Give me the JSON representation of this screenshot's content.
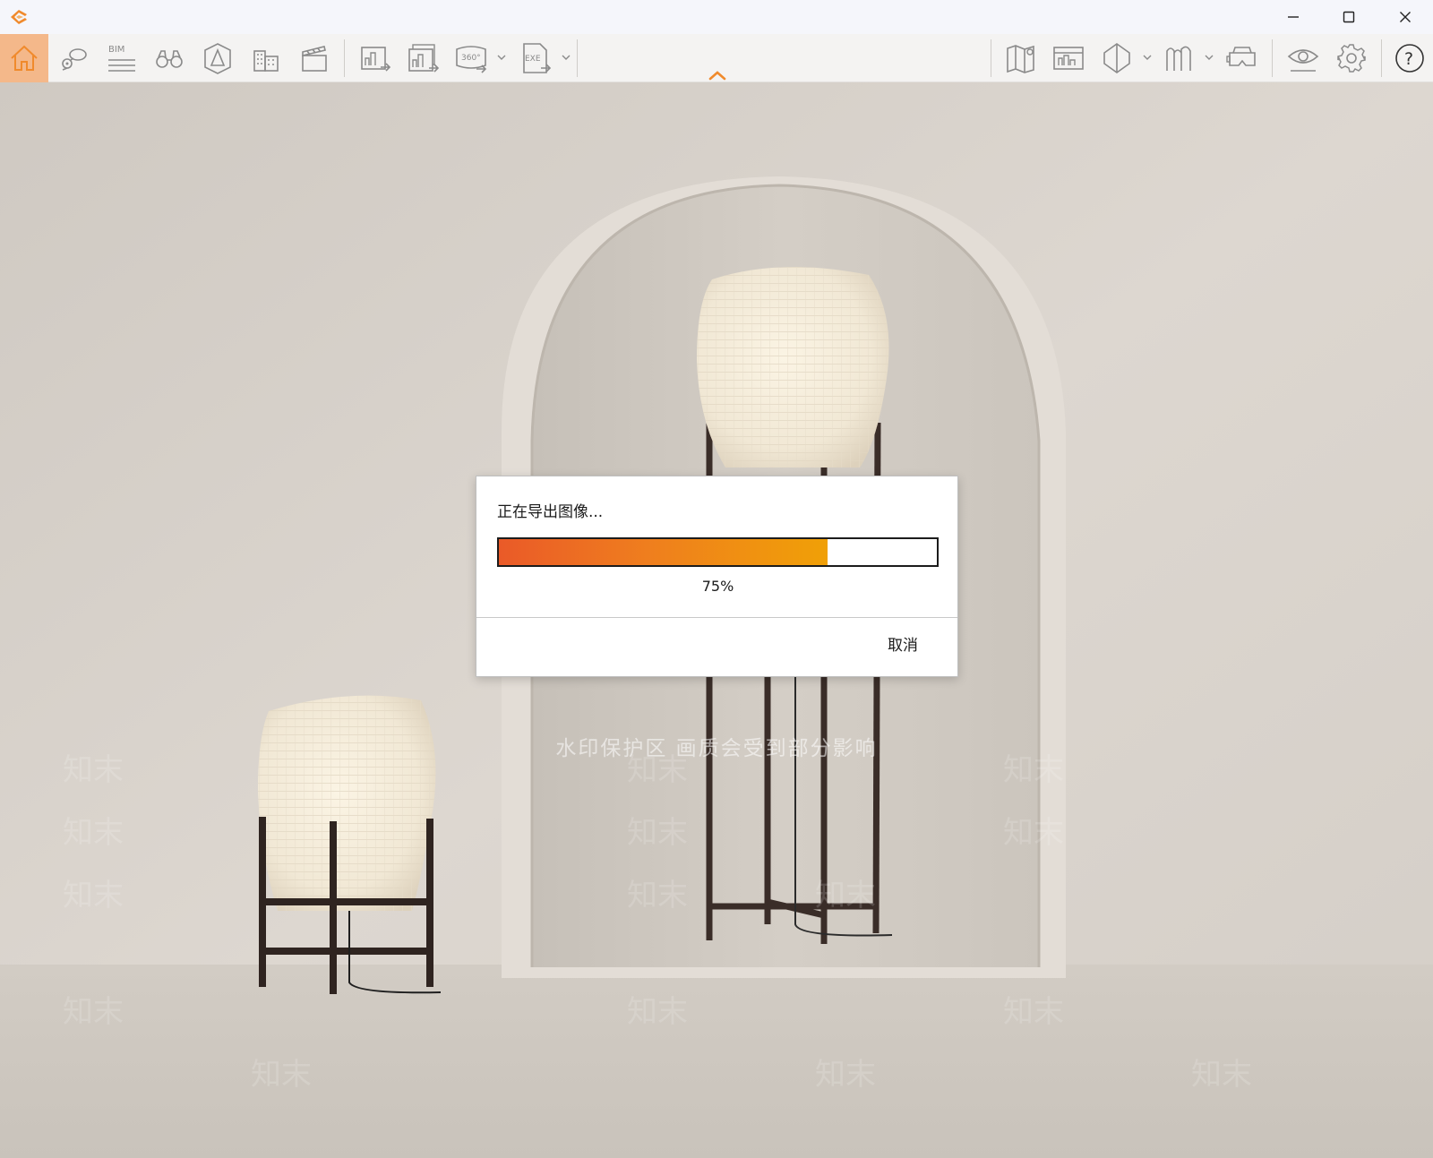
{
  "window": {
    "controls": {
      "minimize": "minimize-icon",
      "maximize": "maximize-icon",
      "close": "close-icon"
    }
  },
  "toolbar": {
    "left_tools": [
      {
        "name": "home",
        "icon": "home-icon",
        "active": true
      },
      {
        "name": "location",
        "icon": "location-pin-icon"
      },
      {
        "name": "bim",
        "icon": "bim-icon",
        "label": "BIM"
      },
      {
        "name": "binoculars",
        "icon": "binoculars-icon"
      },
      {
        "name": "perspective",
        "icon": "perspective-icon"
      },
      {
        "name": "buildings",
        "icon": "buildings-icon"
      },
      {
        "name": "clapperboard",
        "icon": "clapperboard-icon"
      },
      {
        "name": "export-image",
        "icon": "export-image-icon"
      },
      {
        "name": "batch-export",
        "icon": "batch-export-icon"
      },
      {
        "name": "export-360",
        "icon": "export-360-icon",
        "label": "360°",
        "dropdown": true
      },
      {
        "name": "export-exe",
        "icon": "export-exe-icon",
        "label": "EXE",
        "dropdown": true
      }
    ],
    "right_tools": [
      {
        "name": "map",
        "icon": "map-icon"
      },
      {
        "name": "panel",
        "icon": "image-panel-icon"
      },
      {
        "name": "section",
        "icon": "section-icon",
        "dropdown": true
      },
      {
        "name": "fence",
        "icon": "fence-icon",
        "dropdown": true
      },
      {
        "name": "vr",
        "icon": "vr-headset-icon"
      },
      {
        "name": "view",
        "icon": "eye-icon"
      },
      {
        "name": "settings",
        "icon": "gear-icon"
      },
      {
        "name": "help",
        "icon": "help-icon",
        "label": "?"
      }
    ],
    "collapse_icon": "chevron-up-icon",
    "accent": "#f08a2c"
  },
  "scene": {
    "watermark_banner": "水印保护区  画质会受到部分影响",
    "watermark_text": "知末"
  },
  "dialog": {
    "title": "正在导出图像...",
    "progress_fraction": 0.75,
    "progress_label": "75%",
    "cancel_label": "取消",
    "progress_colors": [
      "#ea5a28",
      "#f0a007"
    ]
  }
}
